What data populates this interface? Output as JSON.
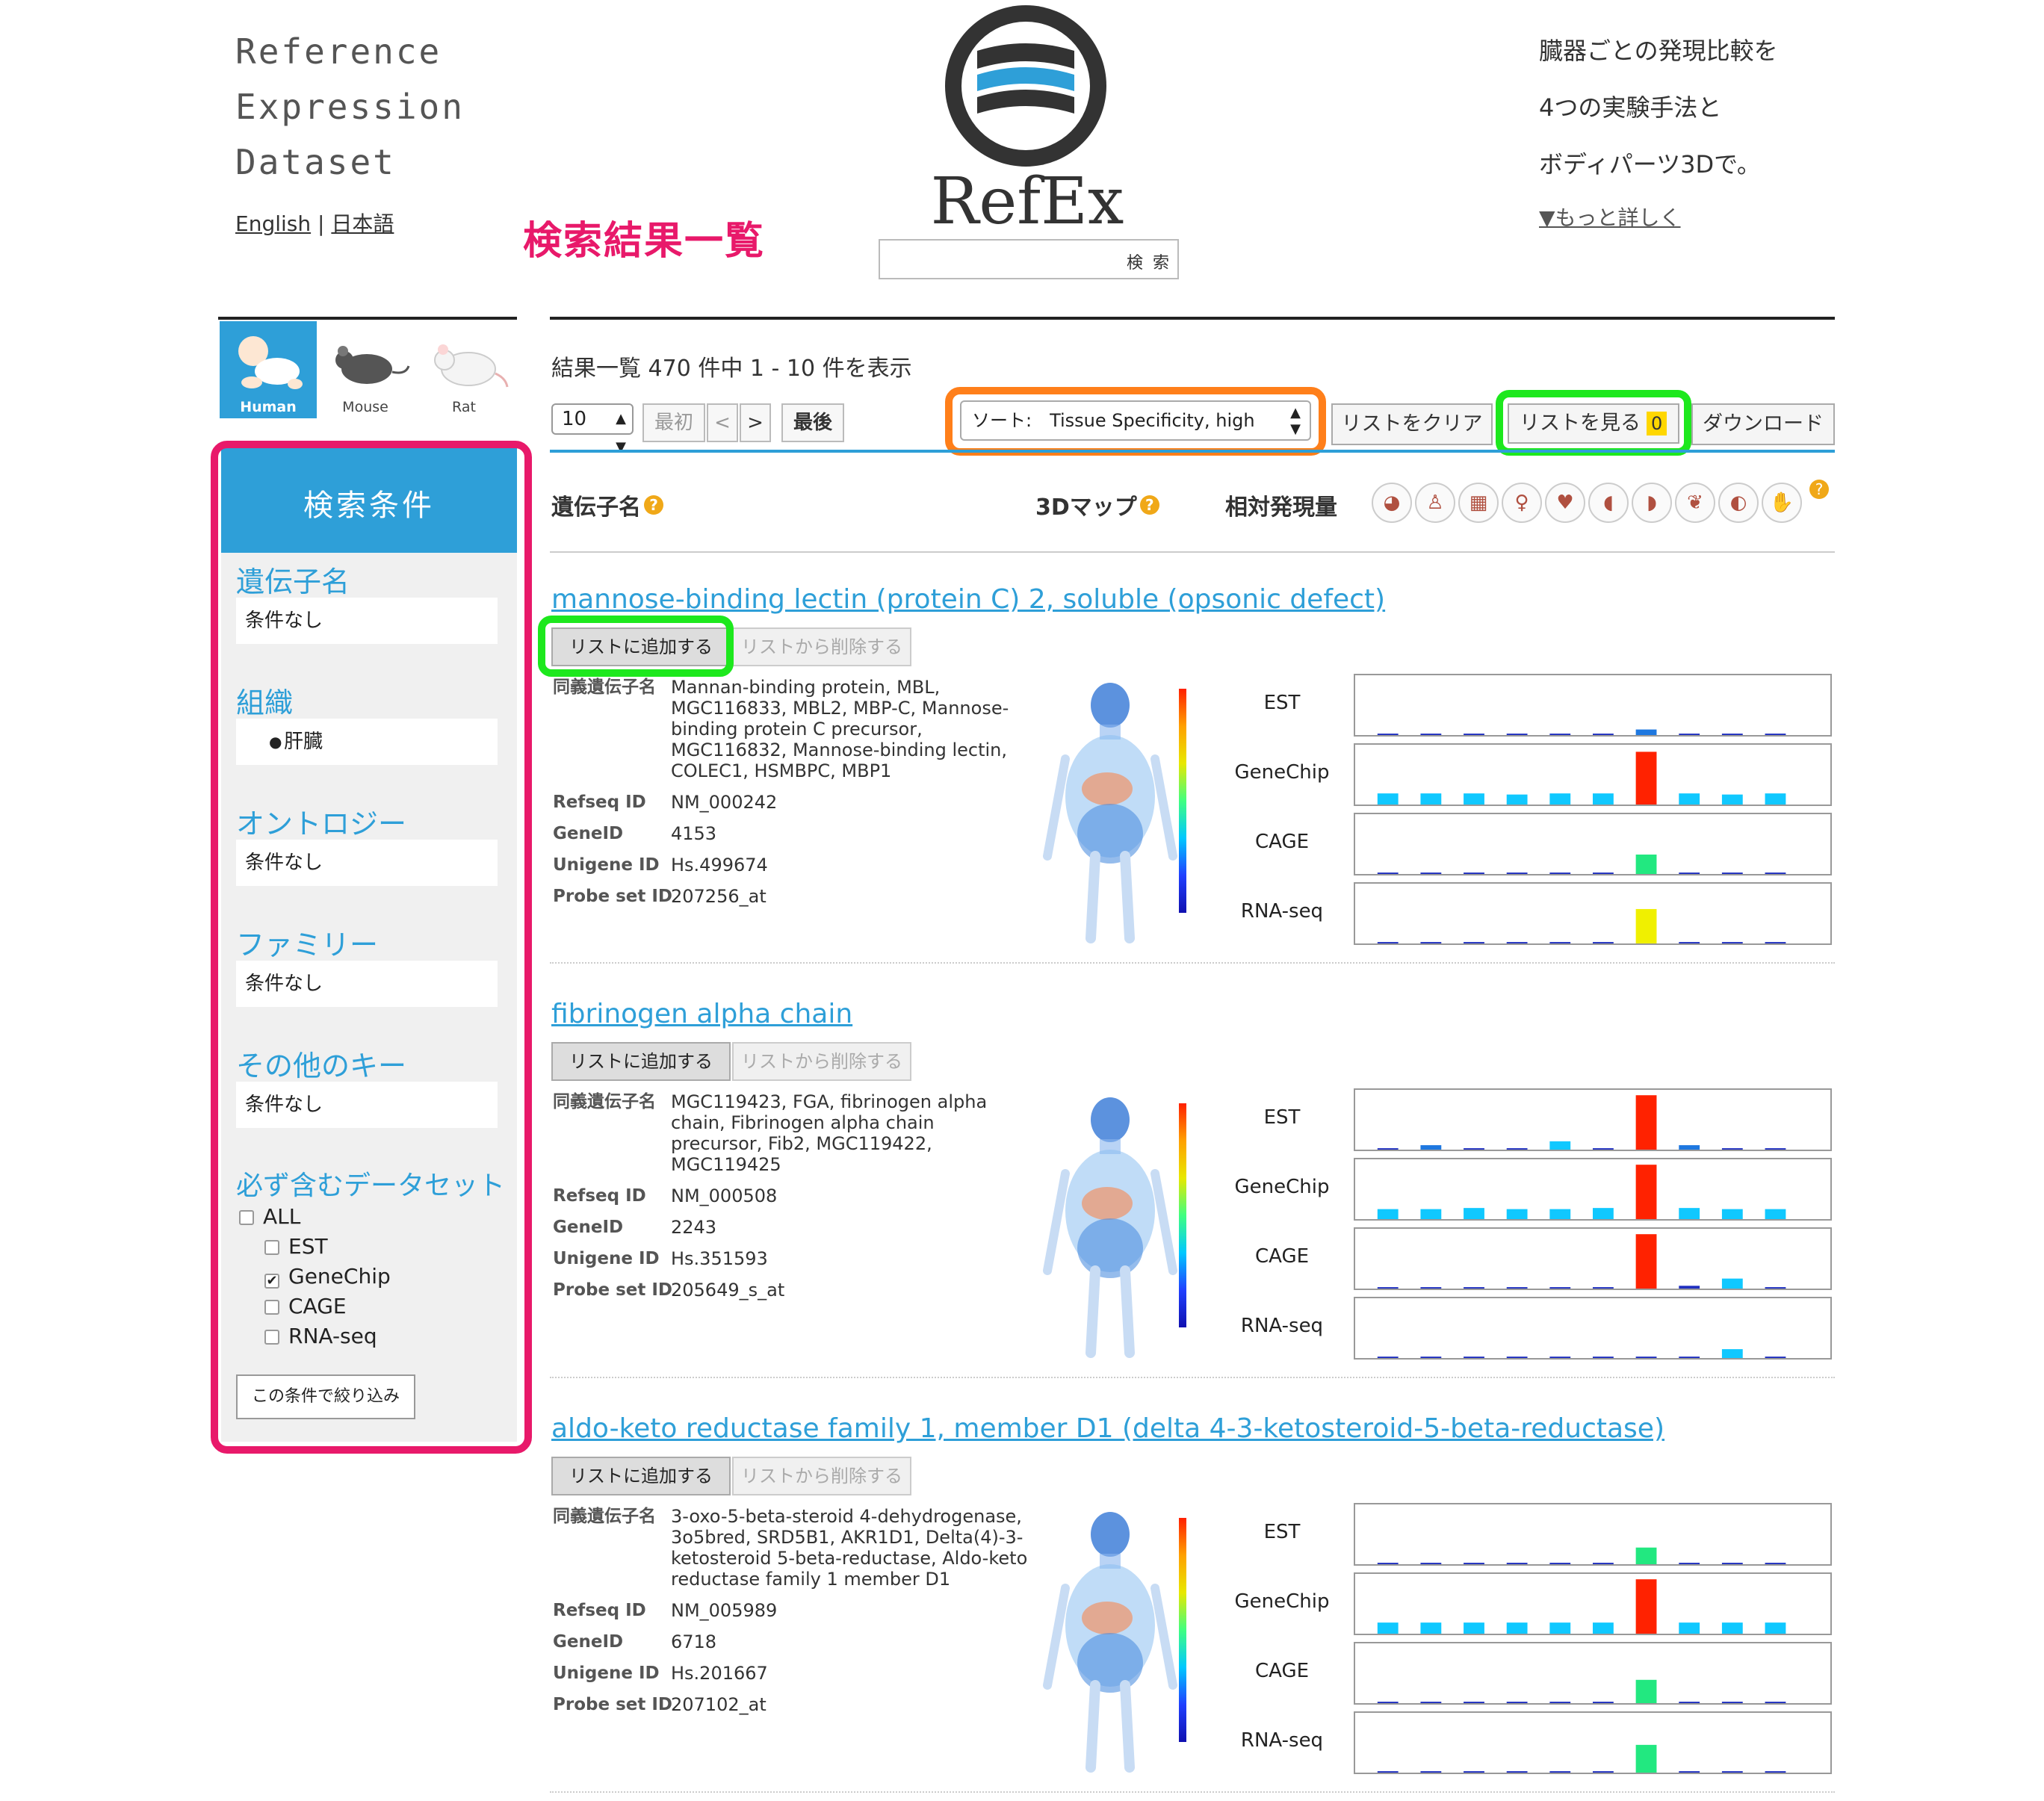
{
  "header": {
    "title_lines": [
      "Reference",
      "Expression",
      "Dataset"
    ],
    "lang_en": "English",
    "lang_sep": "|",
    "lang_ja": "日本語",
    "annotation": "検索結果一覧",
    "logo_text": "RefEx",
    "search_button": "検 索",
    "search_value": "",
    "desc_lines": [
      "臓器ごとの発現比較を",
      "4つの実験手法と",
      "ボディパーツ3Dで。"
    ],
    "more_link": "▼もっと詳しく"
  },
  "species": [
    {
      "label": "Human",
      "selected": true,
      "icon": "baby-icon"
    },
    {
      "label": "Mouse",
      "selected": false,
      "icon": "mouse-icon"
    },
    {
      "label": "Rat",
      "selected": false,
      "icon": "rat-icon"
    }
  ],
  "filter": {
    "heading": "検索条件",
    "gene_name_label": "遺伝子名",
    "gene_name_value": "条件なし",
    "tissue_label": "組織",
    "tissue_value": "肝臓",
    "ontology_label": "オントロジー",
    "ontology_value": "条件なし",
    "family_label": "ファミリー",
    "family_value": "条件なし",
    "other_label": "その他のキー",
    "other_value": "条件なし",
    "dataset_label": "必ず含むデータセット",
    "datasets": [
      {
        "label": "ALL",
        "checked": false
      },
      {
        "label": "EST",
        "checked": false
      },
      {
        "label": "GeneChip",
        "checked": true
      },
      {
        "label": "CAGE",
        "checked": false
      },
      {
        "label": "RNA-seq",
        "checked": false
      }
    ],
    "apply_button": "この条件で絞り込み"
  },
  "results": {
    "summary": "結果一覧 470 件中 1 - 10 件を表示",
    "page_size": "10",
    "first": "最初",
    "prev": "<",
    "next": ">",
    "last": "最後",
    "sort": "ソート:　Tissue Specificity, high",
    "clear_list": "リストをクリア",
    "view_list": "リストを見る",
    "list_count": "0",
    "download": "ダウンロード",
    "col_gene": "遺伝子名",
    "col_3d": "3Dマップ",
    "col_expr": "相対発現量",
    "help": "?"
  },
  "organ_icons": [
    "brain-icon",
    "nervous-system-icon",
    "bone-marrow-icon",
    "uterus-icon",
    "heart-icon",
    "stomach-icon",
    "liver-icon",
    "lung-icon",
    "kidney-icon",
    "muscle-icon"
  ],
  "colors": {
    "accent": "#2e9fd8",
    "annotation": "#e8196a",
    "sort_outline": "#ff7f1a",
    "list_outline": "#1de81d"
  },
  "labels": {
    "add": "リストに追加する",
    "remove": "リストから削除する",
    "synonyms": "同義遺伝子名",
    "refseq": "Refseq ID",
    "geneid": "GeneID",
    "unigene": "Unigene ID",
    "probe": "Probe set ID",
    "datasets": [
      "EST",
      "GeneChip",
      "CAGE",
      "RNA-seq"
    ]
  },
  "genes": [
    {
      "title": "mannose-binding lectin (protein C) 2, soluble (opsonic defect)",
      "synonyms": "Mannan-binding protein, MBL, MGC116833, MBL2, MBP-C, Mannose-binding protein C precursor, MGC116832, Mannose-binding lectin, COLEC1, HSMBPC, MBP1",
      "refseq": "NM_000242",
      "geneid": "4153",
      "unigene": "Hs.499674",
      "probe": "207256_at",
      "expression": [
        [
          0,
          0,
          0,
          0,
          0,
          0,
          0.1,
          0,
          0,
          0
        ],
        [
          0.2,
          0.2,
          0.2,
          0.18,
          0.2,
          0.2,
          0.95,
          0.2,
          0.18,
          0.2
        ],
        [
          0.02,
          0.02,
          0.02,
          0.02,
          0.02,
          0.02,
          0.35,
          0.02,
          0.02,
          0.02
        ],
        [
          0,
          0,
          0,
          0,
          0,
          0,
          0.62,
          0,
          0,
          0
        ]
      ]
    },
    {
      "title": "fibrinogen alpha chain",
      "synonyms": "MGC119423, FGA, fibrinogen alpha chain, Fibrinogen alpha chain precursor, Fib2, MGC119422, MGC119425",
      "refseq": "NM_000508",
      "geneid": "2243",
      "unigene": "Hs.351593",
      "probe": "205649_s_at",
      "expression": [
        [
          0.02,
          0.08,
          0,
          0.02,
          0.15,
          0.02,
          0.98,
          0.08,
          0.02,
          0.02
        ],
        [
          0.18,
          0.18,
          0.2,
          0.18,
          0.18,
          0.2,
          0.98,
          0.2,
          0.18,
          0.18
        ],
        [
          0.02,
          0.02,
          0.02,
          0.02,
          0.02,
          0.02,
          0.98,
          0.05,
          0.18,
          0.02
        ],
        [
          0,
          0,
          0,
          0,
          0,
          0,
          0.02,
          0,
          0.16,
          0
        ]
      ]
    },
    {
      "title": "aldo-keto reductase family 1, member D1 (delta 4-3-ketosteroid-5-beta-reductase)",
      "synonyms": "3-oxo-5-beta-steroid 4-dehydrogenase, 3o5bred, SRD5B1, AKR1D1, Delta(4)-3-ketosteroid 5-beta-reductase, Aldo-keto reductase family 1 member D1",
      "refseq": "NM_005989",
      "geneid": "6718",
      "unigene": "Hs.201667",
      "probe": "207102_at",
      "expression": [
        [
          0.02,
          0,
          0,
          0,
          0,
          0,
          0.3,
          0,
          0,
          0.02
        ],
        [
          0.2,
          0.2,
          0.2,
          0.2,
          0.2,
          0.2,
          0.98,
          0.2,
          0.2,
          0.2
        ],
        [
          0.02,
          0.02,
          0.02,
          0.02,
          0.02,
          0.02,
          0.42,
          0.02,
          0.02,
          0.02
        ],
        [
          0,
          0,
          0,
          0,
          0,
          0,
          0.5,
          0,
          0,
          0
        ]
      ]
    }
  ]
}
